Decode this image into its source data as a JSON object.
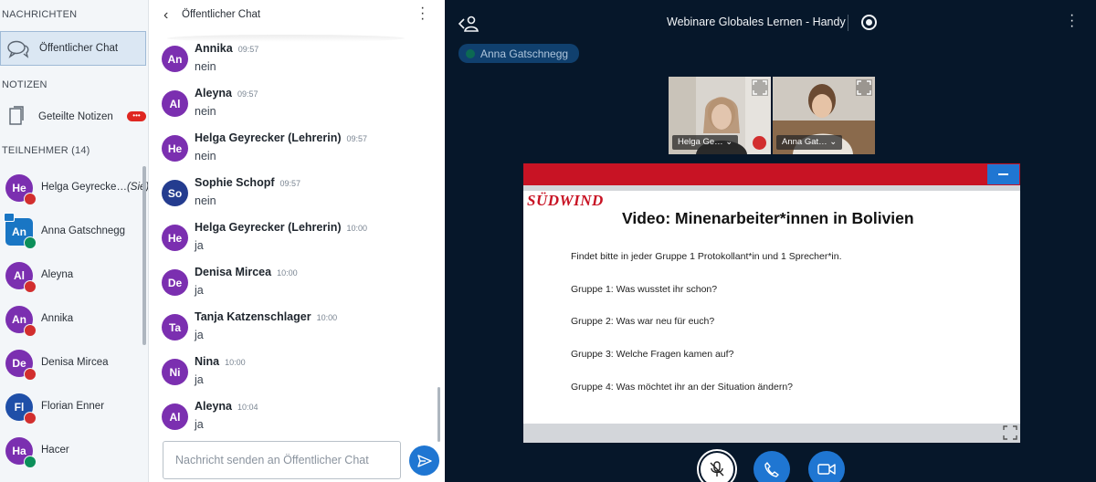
{
  "colors": {
    "accent_blue": "#1f76d2",
    "stage_background": "#06172a",
    "slide_red": "#c81324",
    "mute_red": "#d22e2e",
    "voice_green": "#0c8f5a"
  },
  "sidebar": {
    "messages_heading": "NACHRICHTEN",
    "public_chat_label": "Öffentlicher Chat",
    "notes_heading": "NOTIZEN",
    "shared_notes_label": "Geteilte Notizen",
    "shared_notes_badge": "•••",
    "participants_heading": "TEILNEHMER (14)",
    "participants": [
      {
        "initials": "He",
        "name": "Helga Geyrecke…",
        "suffix": "(Sie)",
        "avatar_color": "#7b2fb0",
        "shape": "circle",
        "audio": "muted"
      },
      {
        "initials": "An",
        "name": "Anna Gatschnegg",
        "suffix": "",
        "avatar_color": "#1976c4",
        "shape": "square",
        "audio": "listening",
        "presenter": true
      },
      {
        "initials": "Al",
        "name": "Aleyna",
        "suffix": "",
        "avatar_color": "#7b2fb0",
        "shape": "circle",
        "audio": "muted"
      },
      {
        "initials": "An",
        "name": "Annika",
        "suffix": "",
        "avatar_color": "#7b2fb0",
        "shape": "circle",
        "audio": "muted"
      },
      {
        "initials": "De",
        "name": "Denisa Mircea",
        "suffix": "",
        "avatar_color": "#7b2fb0",
        "shape": "circle",
        "audio": "muted"
      },
      {
        "initials": "Fl",
        "name": "Florian Enner",
        "suffix": "",
        "avatar_color": "#1f4fa8",
        "shape": "circle",
        "audio": "muted"
      },
      {
        "initials": "Ha",
        "name": "Hacer",
        "suffix": "",
        "avatar_color": "#7b2fb0",
        "shape": "circle",
        "audio": "listening"
      }
    ]
  },
  "chat": {
    "back_icon": "chevron-left-icon",
    "title": "Öffentlicher Chat",
    "input_placeholder": "Nachricht senden an Öffentlicher Chat",
    "messages": [
      {
        "initials": "An",
        "author": "Annika",
        "time": "09:57",
        "text": "nein",
        "avatar_color": "#7b2fb0"
      },
      {
        "initials": "Al",
        "author": "Aleyna",
        "time": "09:57",
        "text": "nein",
        "avatar_color": "#7b2fb0"
      },
      {
        "initials": "He",
        "author": "Helga Geyrecker (Lehrerin)",
        "time": "09:57",
        "text": "nein",
        "avatar_color": "#7b2fb0"
      },
      {
        "initials": "So",
        "author": "Sophie Schopf",
        "time": "09:57",
        "text": "nein",
        "avatar_color": "#243c8f"
      },
      {
        "initials": "He",
        "author": "Helga Geyrecker (Lehrerin)",
        "time": "10:00",
        "text": "ja",
        "avatar_color": "#7b2fb0"
      },
      {
        "initials": "De",
        "author": "Denisa Mircea",
        "time": "10:00",
        "text": "ja",
        "avatar_color": "#7b2fb0"
      },
      {
        "initials": "Ta",
        "author": "Tanja Katzenschlager",
        "time": "10:00",
        "text": "ja",
        "avatar_color": "#7b2fb0"
      },
      {
        "initials": "Ni",
        "author": "Nina",
        "time": "10:00",
        "text": "ja",
        "avatar_color": "#7b2fb0"
      },
      {
        "initials": "Al",
        "author": "Aleyna",
        "time": "10:04",
        "text": "ja",
        "avatar_color": "#7b2fb0"
      }
    ]
  },
  "stage": {
    "meeting_title": "Webinare Globales Lernen - Handy",
    "talking_indicator": "Anna Gatschnegg",
    "videos": [
      {
        "name": "Helga Ge…",
        "muted": true
      },
      {
        "name": "Anna Gat…",
        "muted": false
      }
    ],
    "slide": {
      "logo_text": "SÜDWIND",
      "title": "Video: Minenarbeiter*innen in Bolivien",
      "lines": [
        "Findet bitte in jeder Gruppe 1 Protokollant*in und 1 Sprecher*in.",
        "Gruppe 1: Was wusstet ihr schon?",
        "Gruppe 2: Was war neu für euch?",
        "Gruppe 3: Welche Fragen kamen auf?",
        "Gruppe 4: Was möchtet ihr an der Situation ändern?"
      ]
    },
    "controls": [
      "microphone-muted",
      "phone",
      "camera"
    ]
  }
}
